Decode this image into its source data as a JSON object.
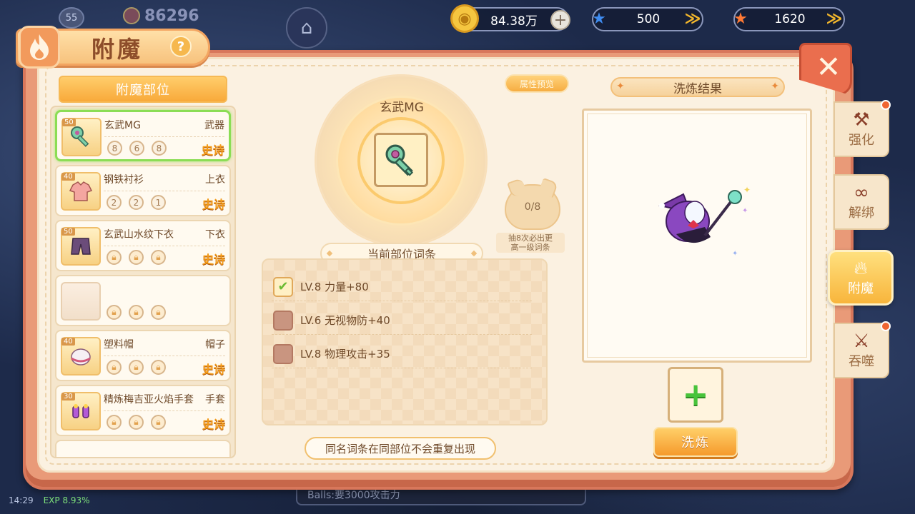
{
  "hud": {
    "level": "55",
    "power": "86296",
    "coins": "84.38万",
    "tickets_blue": "500",
    "tickets_orange": "1620"
  },
  "dialog": {
    "title": "附魔",
    "help": "?",
    "close": "✕"
  },
  "left_panel": {
    "header": "附魔部位",
    "items": [
      {
        "level": "50",
        "name": "玄武MG",
        "slot": "武器",
        "rarity": "史诗",
        "dots": [
          "8",
          "6",
          "8"
        ],
        "locked": false,
        "icon": "key-icon"
      },
      {
        "level": "40",
        "name": "钢铁衬衫",
        "slot": "上衣",
        "rarity": "史诗",
        "dots": [
          "2",
          "2",
          "1"
        ],
        "locked": false,
        "icon": "shirt-icon"
      },
      {
        "level": "50",
        "name": "玄武山水纹下衣",
        "slot": "下衣",
        "rarity": "史诗",
        "dots": [
          "",
          "",
          ""
        ],
        "locked": true,
        "icon": "pants-icon"
      },
      {
        "level": "",
        "name": "",
        "slot": "",
        "rarity": "",
        "dots": [
          "",
          "",
          ""
        ],
        "locked": true,
        "icon": "empty-slot-icon"
      },
      {
        "level": "40",
        "name": "塑料帽",
        "slot": "帽子",
        "rarity": "史诗",
        "dots": [
          "",
          "",
          ""
        ],
        "locked": true,
        "icon": "hat-icon"
      },
      {
        "level": "30",
        "name": "精炼梅吉亚火焰手套",
        "slot": "手套",
        "rarity": "史诗",
        "dots": [
          "",
          "",
          ""
        ],
        "locked": true,
        "icon": "glove-icon"
      }
    ]
  },
  "center": {
    "equip_name": "玄武MG",
    "preview_button": "属性预览",
    "draw_count": "0/8",
    "draw_hint_line1": "抽8次必出更",
    "draw_hint_line2": "高一级词条",
    "section_title": "当前部位词条",
    "affixes": [
      {
        "text": "LV.8  力量+80",
        "checked": true
      },
      {
        "text": "LV.6  无视物防+40",
        "checked": false
      },
      {
        "text": "LV.8  物理攻击+35",
        "checked": false
      }
    ],
    "note": "同名词条在同部位不会重复出现"
  },
  "right_panel": {
    "title": "洗炼结果",
    "add_button": "+",
    "refine_button": "洗炼"
  },
  "side_tabs": [
    {
      "label": "强化",
      "active": false,
      "red_dot": true,
      "icon": "anvil-icon"
    },
    {
      "label": "解绑",
      "active": false,
      "red_dot": false,
      "icon": "chain-icon"
    },
    {
      "label": "附魔",
      "active": true,
      "red_dot": false,
      "icon": "flame-icon"
    },
    {
      "label": "吞噬",
      "active": false,
      "red_dot": true,
      "icon": "crossed-swords-icon"
    }
  ],
  "bottom_bar": {
    "text": "Balls:要3000攻击力"
  },
  "status": {
    "time": "14:29",
    "exp": "EXP 8.93%"
  },
  "colors": {
    "accent_orange": "#f8a93a",
    "rarity_epic": "#f49c1a",
    "selected_border": "#8bdd55",
    "dialog_border": "#e99a78"
  }
}
